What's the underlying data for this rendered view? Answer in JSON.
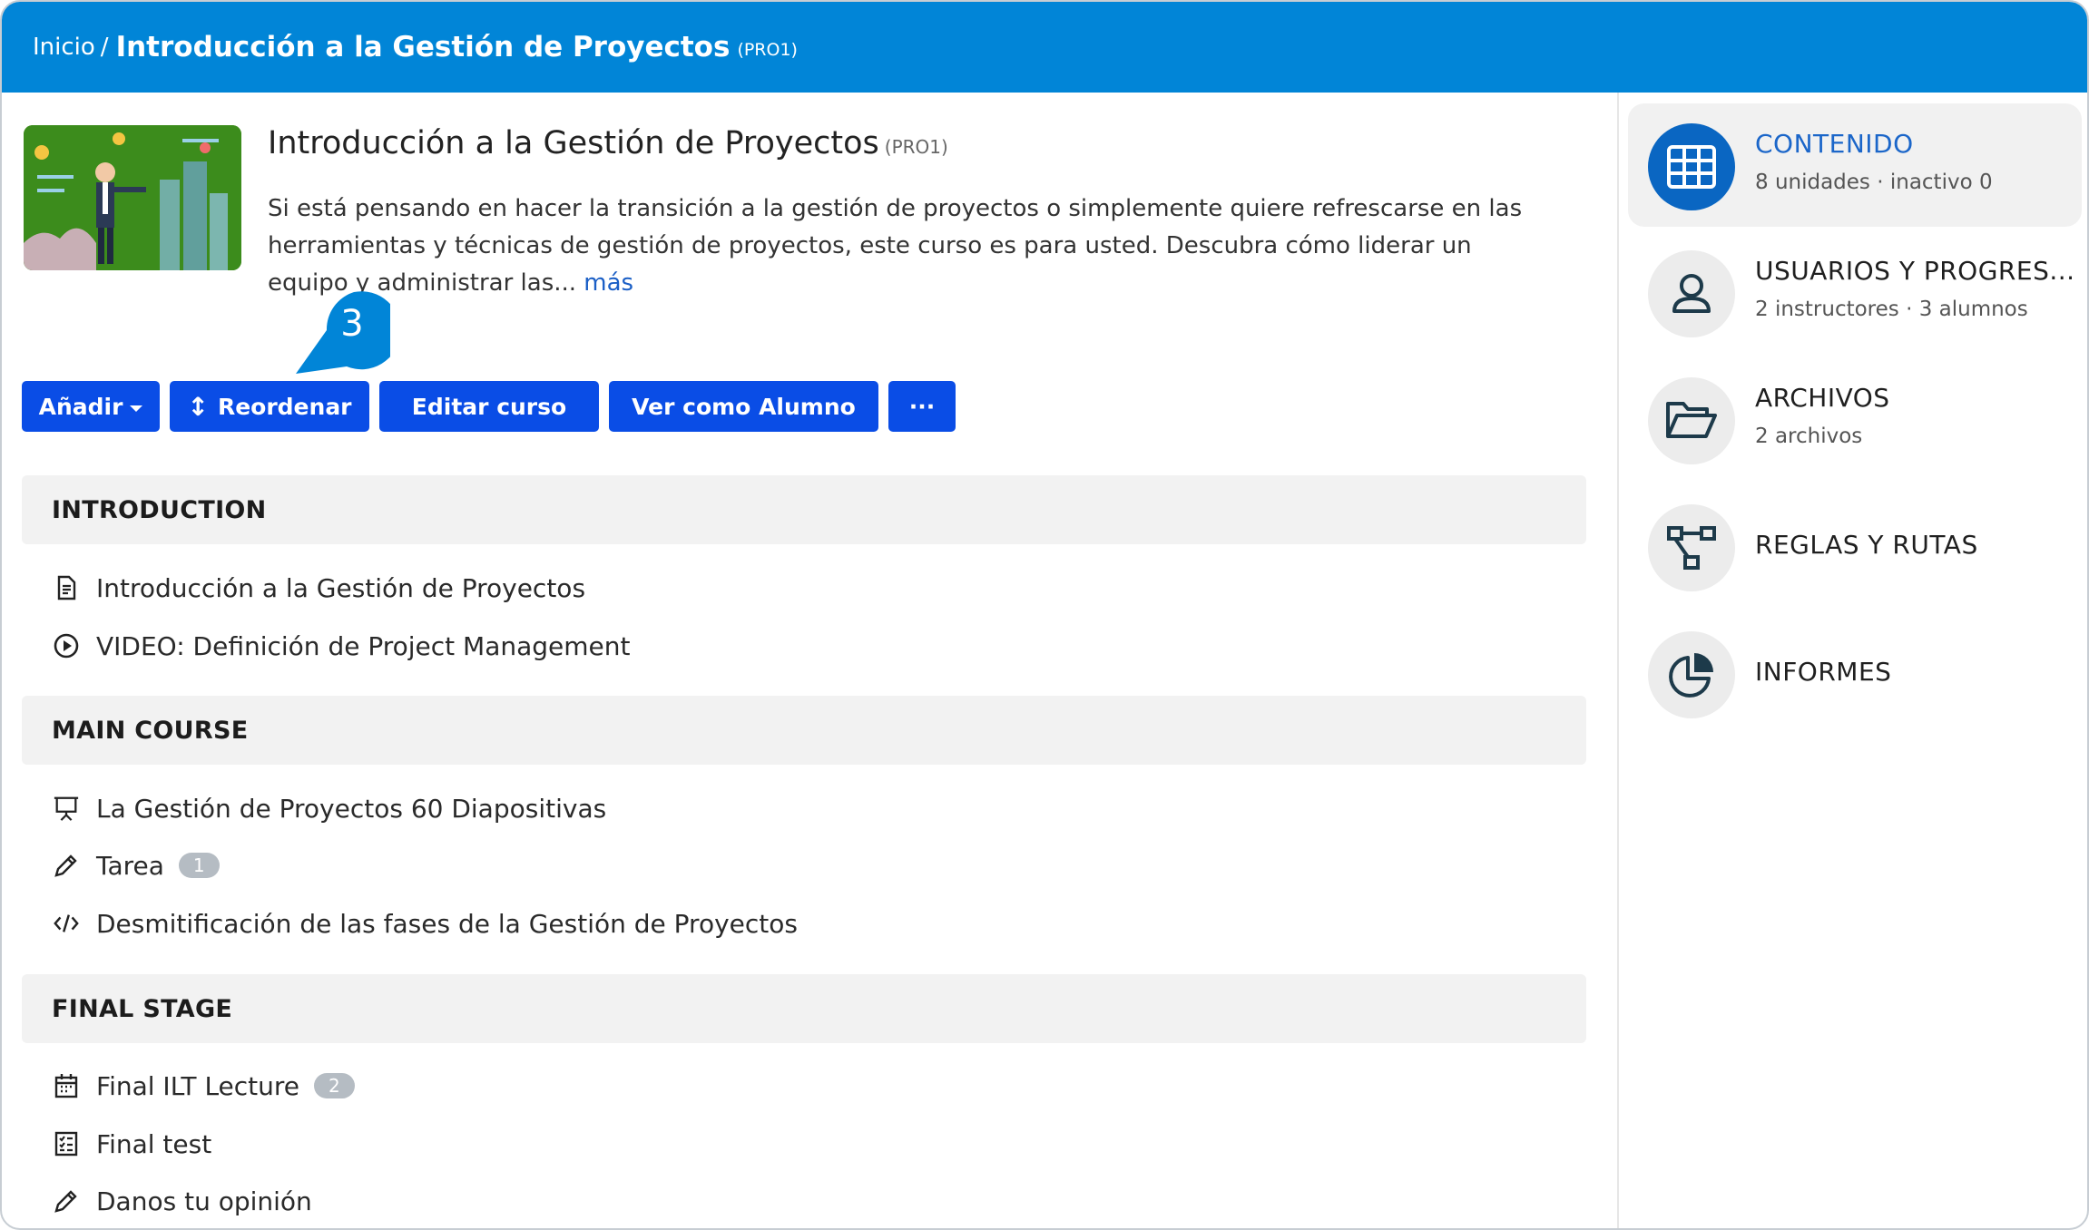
{
  "header": {
    "home": "Inicio",
    "separator": "/",
    "title": "Introducción a la Gestión de Proyectos",
    "code": "(PRO1)"
  },
  "course": {
    "title": "Introducción a la Gestión de Proyectos",
    "code": "(PRO1)",
    "description": "Si está pensando en hacer la transición a la gestión de proyectos o simplemente quiere refrescarse en las herramientas y técnicas de gestión de proyectos, este curso es para usted. Descubra cómo liderar un equipo y administrar las...",
    "more": "más"
  },
  "callout": {
    "number": "3",
    "color": "#0185d7"
  },
  "toolbar": {
    "add": "Añadir",
    "reorder": "Reordenar",
    "edit": "Editar curso",
    "view_as_learner": "Ver como Alumno",
    "more": "···"
  },
  "sections": [
    {
      "title": "INTRODUCTION",
      "units": [
        {
          "icon": "document-icon",
          "label": "Introducción a la Gestión de Proyectos",
          "badge": ""
        },
        {
          "icon": "play-circle-icon",
          "label": "VIDEO: Definición de Project Management",
          "badge": ""
        }
      ]
    },
    {
      "title": "MAIN COURSE",
      "units": [
        {
          "icon": "presentation-icon",
          "label": "La Gestión de Proyectos 60 Diapositivas",
          "badge": ""
        },
        {
          "icon": "pencil-icon",
          "label": "Tarea",
          "badge": "1"
        },
        {
          "icon": "code-icon",
          "label": "Desmitificación de las fases de la Gestión de Proyectos",
          "badge": ""
        }
      ]
    },
    {
      "title": "FINAL STAGE",
      "units": [
        {
          "icon": "calendar-icon",
          "label": "Final ILT Lecture",
          "badge": "2"
        },
        {
          "icon": "checklist-icon",
          "label": "Final test",
          "badge": ""
        },
        {
          "icon": "pencil-icon",
          "label": "Danos tu opinión",
          "badge": ""
        }
      ]
    }
  ],
  "sidebar": {
    "items": [
      {
        "label": "CONTENIDO",
        "sub": "8 unidades · inactivo 0",
        "icon": "grid-icon",
        "active": true
      },
      {
        "label": "USUARIOS Y PROGRES...",
        "sub": "2 instructores · 3 alumnos",
        "icon": "user-icon",
        "active": false
      },
      {
        "label": "ARCHIVOS",
        "sub": "2 archivos",
        "icon": "folder-open-icon",
        "active": false
      },
      {
        "label": "REGLAS Y RUTAS",
        "sub": "",
        "icon": "flow-icon",
        "active": false
      },
      {
        "label": "INFORMES",
        "sub": "",
        "icon": "pie-chart-icon",
        "active": false
      }
    ]
  },
  "colors": {
    "header_bg": "#0185d7",
    "button_bg": "#0a4de6",
    "active_blue": "#1b66c9",
    "section_bg": "#f2f2f2",
    "badge_bg": "#b5bcc3",
    "icon_dark": "#1d3a4a"
  }
}
